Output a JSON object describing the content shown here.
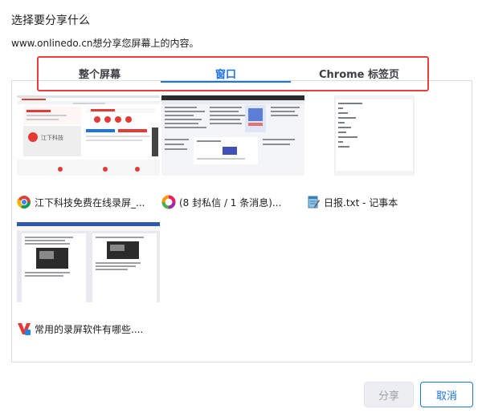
{
  "dialog": {
    "title": "选择要分享什么",
    "subtitle": "www.onlinedo.cn想分享您屏幕上的内容。"
  },
  "tabs": [
    {
      "label": "整个屏幕",
      "selected": false
    },
    {
      "label": "窗口",
      "selected": true
    },
    {
      "label": "Chrome 标签页",
      "selected": false
    }
  ],
  "windows": [
    {
      "label": "江下科技免费在线录屏_...",
      "icon": "chrome-icon"
    },
    {
      "label": "(8 封私信 / 1 条消息)...",
      "icon": "colorful-ring-icon"
    },
    {
      "label": "日报.txt - 记事本",
      "icon": "notepad-icon"
    },
    {
      "label": "常用的录屏软件有哪些....",
      "icon": "wps-writer-icon"
    }
  ],
  "thumbnail_texts": {
    "brand": "江下科技"
  },
  "buttons": {
    "share": "分享",
    "cancel": "取消"
  },
  "colors": {
    "accent": "#1a73e8",
    "highlight_border": "#e8413c",
    "disabled_bg": "#eceef1"
  }
}
